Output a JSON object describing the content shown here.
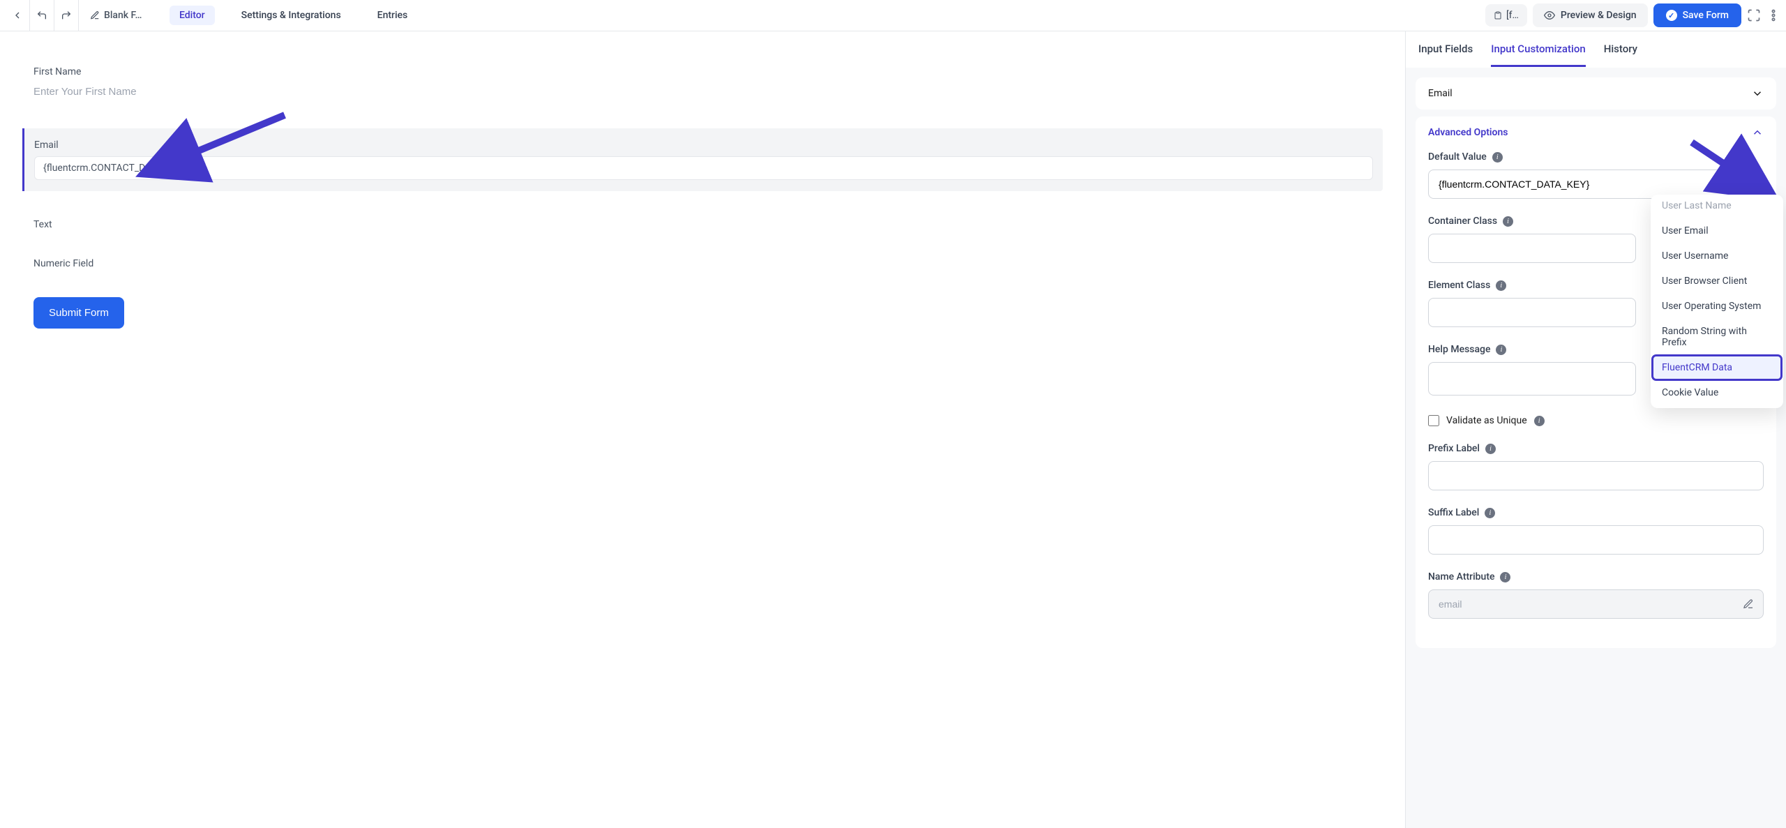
{
  "topbar": {
    "form_name": "Blank F…",
    "tabs": {
      "editor": "Editor",
      "settings": "Settings & Integrations",
      "entries": "Entries"
    },
    "shortcode_label": "[f…",
    "preview_label": "Preview & Design",
    "save_label": "Save Form"
  },
  "canvas": {
    "first_name_label": "First Name",
    "first_name_placeholder": "Enter Your First Name",
    "email_label": "Email",
    "email_value": "{fluentcrm.CONTACT_DATA_KEY}",
    "text_label": "Text",
    "numeric_label": "Numeric Field",
    "submit_label": "Submit Form"
  },
  "sidebar": {
    "tabs": {
      "input_fields": "Input Fields",
      "input_custom": "Input Customization",
      "history": "History"
    },
    "email_section": "Email",
    "advanced_section": "Advanced Options",
    "default_value_label": "Default Value",
    "default_value": "{fluentcrm.CONTACT_DATA_KEY}",
    "container_class_label": "Container Class",
    "element_class_label": "Element Class",
    "help_message_label": "Help Message",
    "validate_unique_label": "Validate as Unique",
    "prefix_label": "Prefix Label",
    "suffix_label": "Suffix Label",
    "name_attr_label": "Name Attribute",
    "name_attr_value": "email"
  },
  "dropdown": {
    "items": [
      "User Last Name",
      "User Email",
      "User Username",
      "User Browser Client",
      "User Operating System",
      "Random String with Prefix",
      "FluentCRM Data",
      "Cookie Value"
    ],
    "highlight_index": 6
  }
}
